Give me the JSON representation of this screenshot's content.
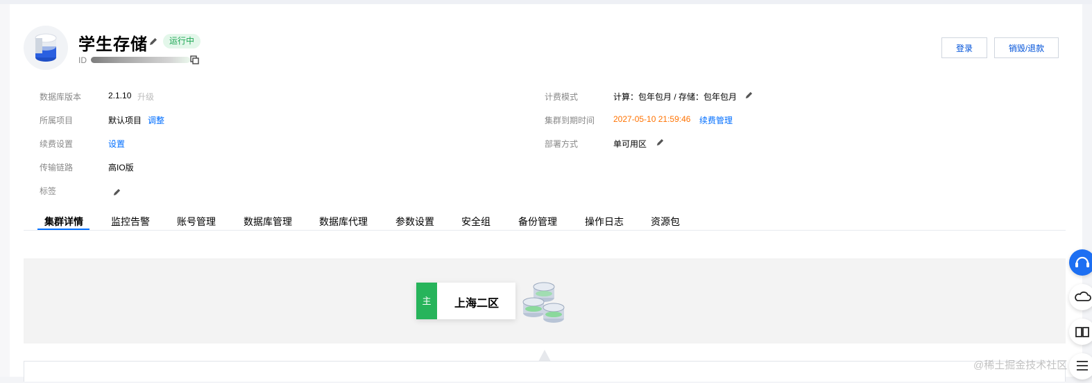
{
  "instance": {
    "title": "学生存储",
    "status": "运行中",
    "id_label": "ID"
  },
  "actions": {
    "login": "登录",
    "destroy": "销毁/退款"
  },
  "info_left": {
    "db_version_label": "数据库版本",
    "db_version_value": "2.1.10",
    "upgrade": "升级",
    "project_label": "所属项目",
    "project_value": "默认项目",
    "adjust": "调整",
    "renew_label": "续费设置",
    "renew_value": "设置",
    "link_label": "传输链路",
    "link_value": "高IO版",
    "tag_label": "标签"
  },
  "info_right": {
    "billing_label": "计费模式",
    "billing_value": "计算：包年包月 / 存储：包年包月",
    "expire_label": "集群到期时间",
    "expire_value": "2027-05-10 21:59:46",
    "renew_manage": "续费管理",
    "deploy_label": "部署方式",
    "deploy_value": "单可用区"
  },
  "tabs": [
    "集群详情",
    "监控告警",
    "账号管理",
    "数据库管理",
    "数据库代理",
    "参数设置",
    "安全组",
    "备份管理",
    "操作日志",
    "资源包"
  ],
  "topology": {
    "role": "主",
    "region": "上海二区"
  },
  "watermark": "@稀土掘金技术社区",
  "colors": {
    "accent": "#006eff",
    "status_green": "#1ca653",
    "warn_orange": "#ff7200"
  }
}
